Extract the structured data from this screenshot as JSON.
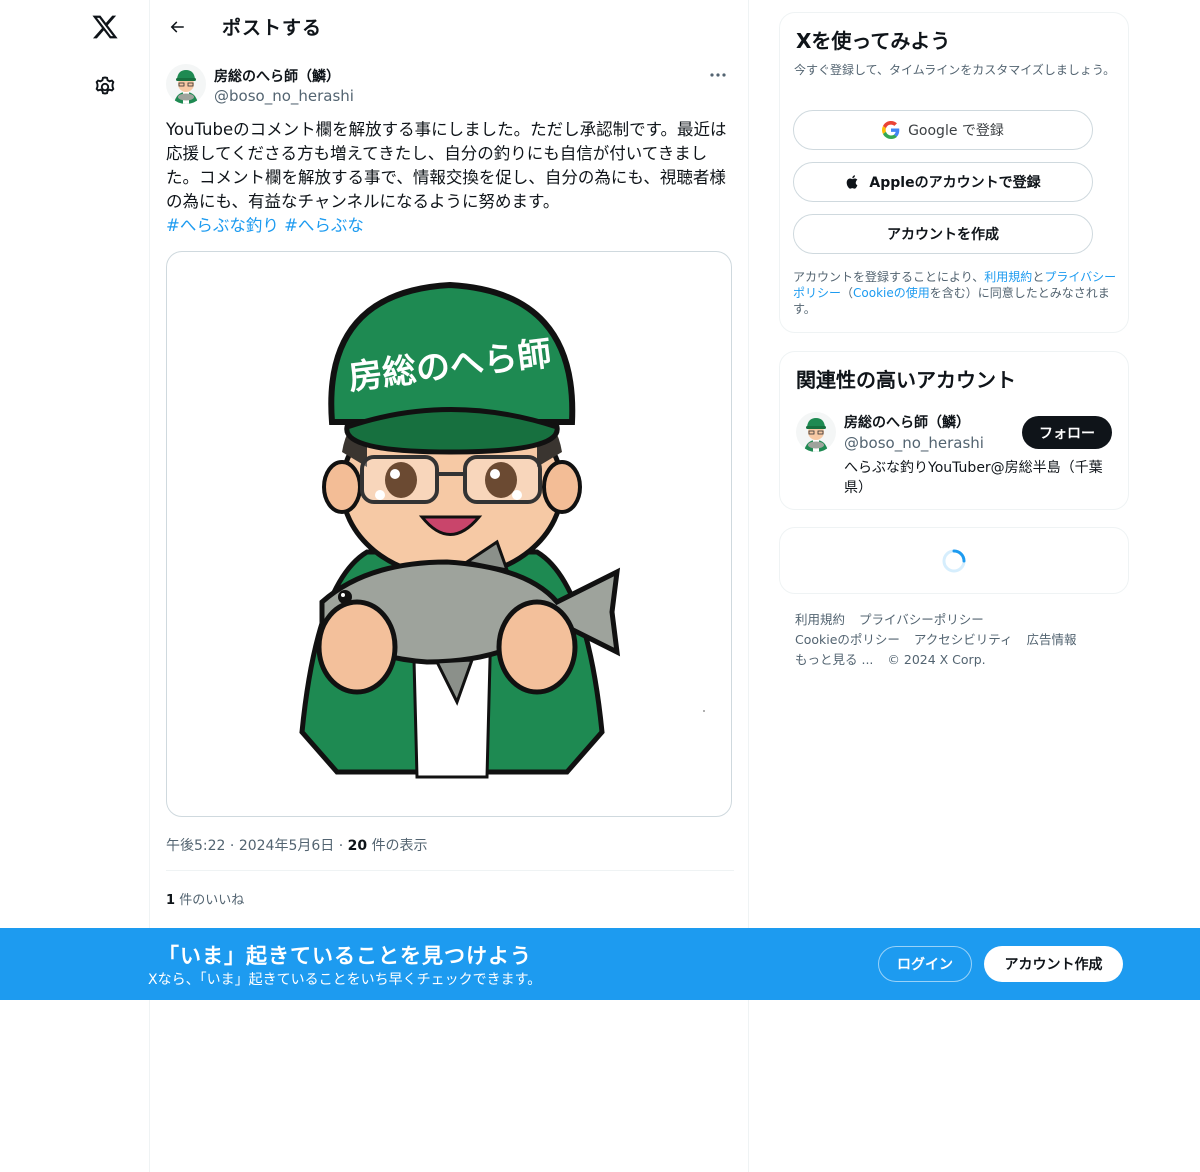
{
  "nav": {
    "logo": "x-logo-icon",
    "settings": "gear-icon"
  },
  "header": {
    "title": "ポストする"
  },
  "post": {
    "author_name": "房総のへら師（鱗）",
    "author_handle": "@boso_no_herashi",
    "text": "YouTubeのコメント欄を解放する事にしました。ただし承認制です。最近は応援してくださる方も増えてきたし、自分の釣りにも自信が付いてきました。コメント欄を解放する事で、情報交換を促し、自分の為にも、視聴者様の為にも、有益なチャンネルになるように努めます。",
    "hashtags": [
      "#へらぶな釣り",
      "#へらぶな"
    ],
    "image_text": "房総のへら師",
    "time": "午後5:22",
    "date": "2024年5月6日",
    "views_count": "20",
    "views_label": "件の表示",
    "likes_count": "1",
    "likes_label": "件のいいね"
  },
  "sidebar": {
    "signup": {
      "title": "Xを使ってみよう",
      "subtitle": "今すぐ登録して、タイムラインをカスタマイズしましょう。",
      "google_label": "Google で登録",
      "apple_label": "Appleのアカウントで登録",
      "create_label": "アカウントを作成",
      "terms_prefix": "アカウントを登録することにより、",
      "terms_link": "利用規約",
      "terms_and": "と",
      "privacy_link": "プライバシーポリシー",
      "paren_open": "（",
      "cookie_link": "Cookieの使用",
      "terms_suffix": "を含む）に同意したとみなされます。"
    },
    "related": {
      "title": "関連性の高いアカウント",
      "name": "房総のへら師（鱗）",
      "handle": "@boso_no_herashi",
      "bio": "へらぶな釣りYouTuber@房総半島（千葉県）",
      "follow_label": "フォロー"
    },
    "footer": {
      "terms": "利用規約",
      "privacy": "プライバシーポリシー",
      "cookie": "Cookieのポリシー",
      "accessibility": "アクセシビリティ",
      "ads": "広告情報",
      "more": "もっと見る ...",
      "copyright": "© 2024 X Corp."
    }
  },
  "bottom_bar": {
    "title": "「いま」起きていることを見つけよう",
    "subtitle": "Xなら、「いま」起きていることをいち早くチェックできます。",
    "login_label": "ログイン",
    "signup_label": "アカウント作成"
  },
  "colors": {
    "accent": "#1d9bf0",
    "text": "#0f1419",
    "secondary": "#536471",
    "border": "#eff3f4",
    "cap_green": "#1e8a52"
  }
}
